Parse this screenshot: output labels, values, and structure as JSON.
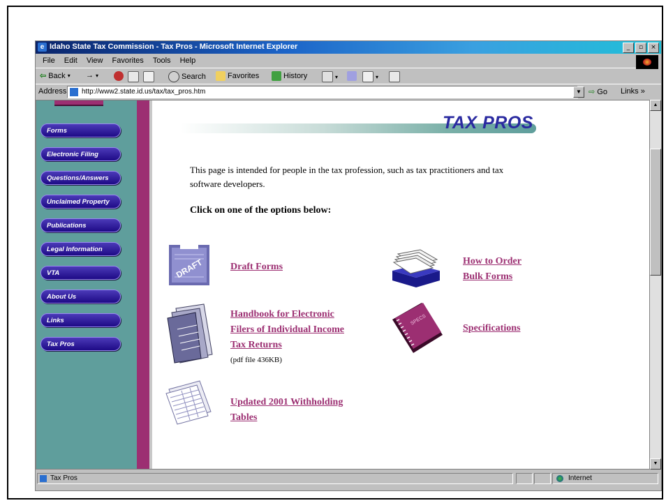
{
  "window": {
    "title": "Idaho State Tax Commission - Tax Pros - Microsoft Internet Explorer",
    "buttons": {
      "minimize": "_",
      "maximize": "▫",
      "close": "×"
    }
  },
  "menubar": [
    "File",
    "Edit",
    "View",
    "Favorites",
    "Tools",
    "Help"
  ],
  "toolbar": {
    "back": "Back",
    "forward": "→",
    "search": "Search",
    "favorites": "Favorites",
    "history": "History"
  },
  "address": {
    "label": "Address",
    "url": "http://www2.state.id.us/tax/tax_pros.htm",
    "go": "Go",
    "links": "Links »"
  },
  "sidebar": {
    "items": [
      {
        "label": "Forms"
      },
      {
        "label": "Electronic Filing"
      },
      {
        "label": "Questions/Answers"
      },
      {
        "label": "Unclaimed Property"
      },
      {
        "label": "Publications"
      },
      {
        "label": "Legal Information"
      },
      {
        "label": "VTA"
      },
      {
        "label": "About Us"
      },
      {
        "label": "Links"
      },
      {
        "label": "Tax Pros"
      }
    ]
  },
  "main": {
    "banner_title": "TAX PROS",
    "intro": "This page is intended for people in the tax profession, such as tax practitioners and tax software developers.",
    "instruction": "Click on one of the options below:",
    "links": {
      "draft_forms": "Draft Forms",
      "bulk_forms_line1": "How to Order",
      "bulk_forms_line2": "Bulk Forms",
      "handbook_line1": "Handbook for Electronic",
      "handbook_line2": "Filers of Individual Income",
      "handbook_line3": "Tax Returns",
      "handbook_note": "(pdf file 436KB)",
      "specifications": "Specifications",
      "withholding_line1": "Updated 2001 Withholding",
      "withholding_line2": "Tables"
    },
    "icon_text": {
      "draft": "DRAFT",
      "spec_book": "SPECS"
    }
  },
  "statusbar": {
    "text": "Tax Pros",
    "zone": "Internet"
  },
  "colors": {
    "nav_bg": "#5f9e9c",
    "stripe": "#9c2f72",
    "link": "#9c2f72",
    "title_blue": "#2a2aa0",
    "button_blue": "#1e0a86"
  }
}
